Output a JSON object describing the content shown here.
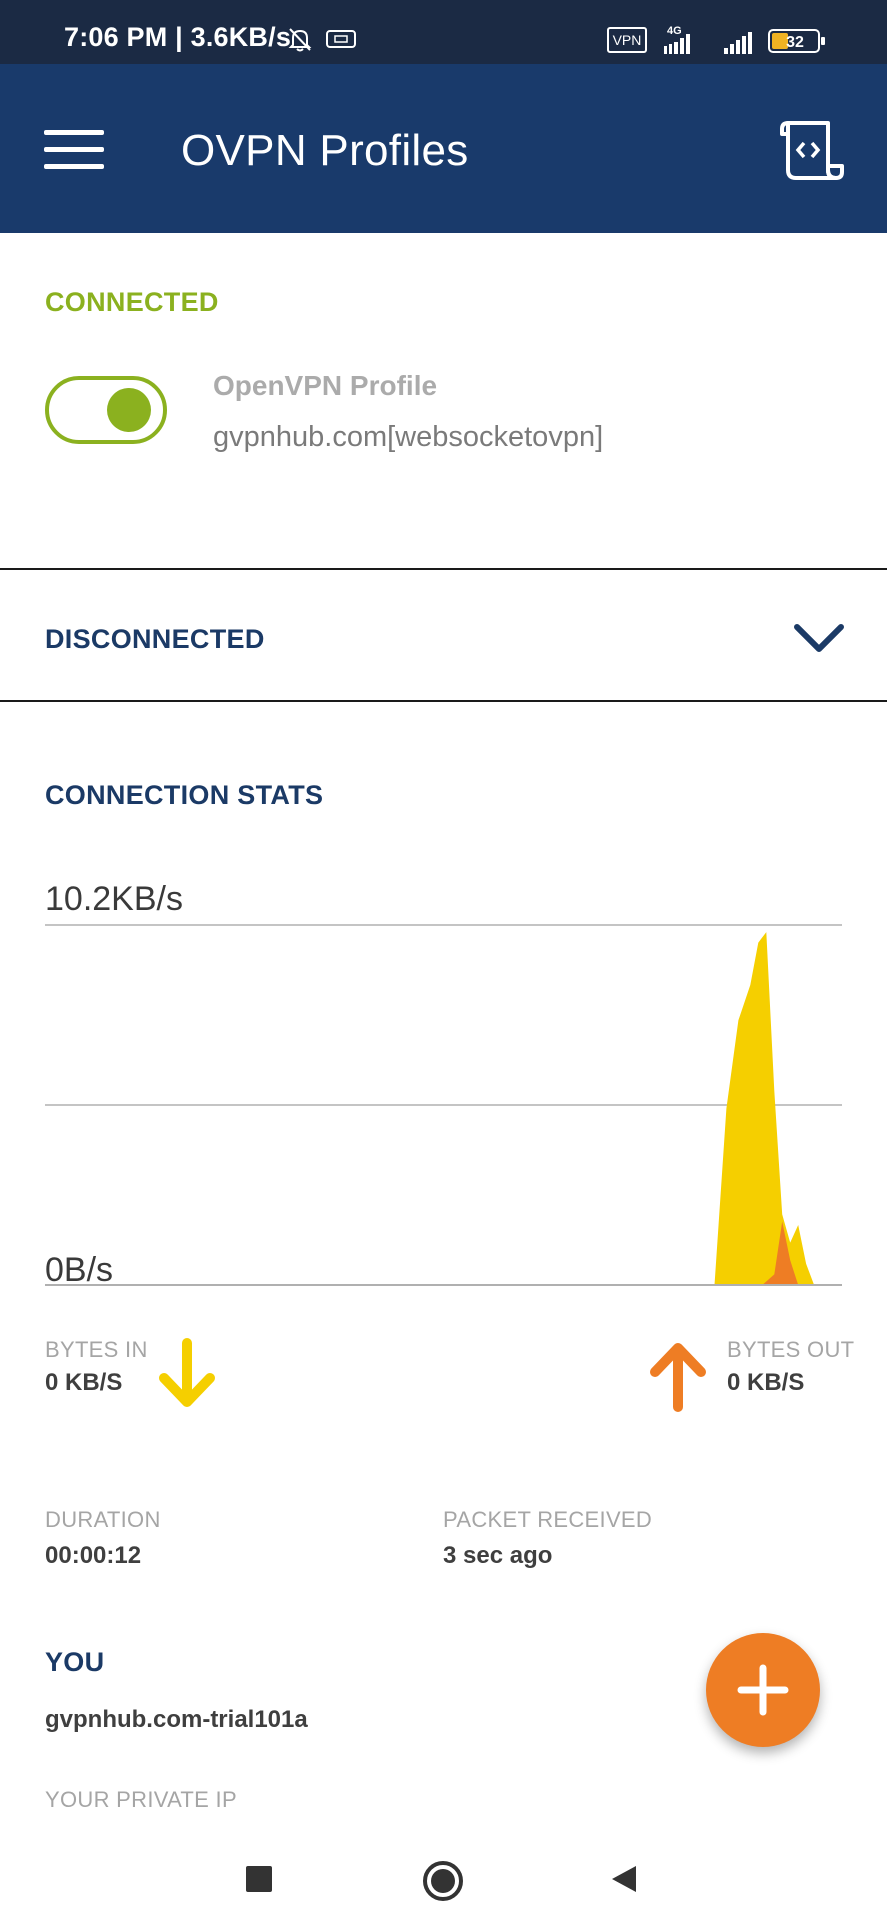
{
  "status_bar": {
    "time_speed": "7:06 PM | 3.6KB/s",
    "vpn_badge": "VPN",
    "network_type": "4G",
    "battery": "32",
    "icons": [
      "bell-off-icon",
      "card-icon",
      "vpn-icon",
      "signal-icon",
      "battery-icon"
    ]
  },
  "app_bar": {
    "title": "OVPN Profiles",
    "icons": [
      "menu-icon",
      "script-icon"
    ]
  },
  "connected_section": {
    "header": "CONNECTED",
    "profile_name": "OpenVPN Profile",
    "profile_server": "gvpnhub.com[websocketovpn]",
    "toggle_on": true
  },
  "disconnected_section": {
    "header": "DISCONNECTED",
    "icon": "chevron-down-icon"
  },
  "stats": {
    "header": "CONNECTION STATS",
    "bytes_in_label": "BYTES IN",
    "bytes_in_value": "0 KB/S",
    "bytes_out_label": "BYTES OUT",
    "bytes_out_value": "0 KB/S",
    "duration_label": "DURATION",
    "duration_value": "00:00:12",
    "packet_label": "PACKET RECEIVED",
    "packet_value": "3 sec ago"
  },
  "you_section": {
    "header": "YOU",
    "username": "gvpnhub.com-trial101a",
    "private_ip_label": "YOUR PRIVATE IP"
  },
  "colors": {
    "status_bar": "#1b2a44",
    "app_bar": "#193a6b",
    "connected_green": "#8bb11f",
    "navy_text": "#1b3a66",
    "bytes_in_yellow": "#f5cf00",
    "bytes_out_orange": "#ee7d24",
    "fab_orange": "#ee7d24"
  },
  "chart_data": {
    "type": "area",
    "y_top_label": "10.2KB/s",
    "y_bottom_label": "0B/s",
    "ylim": [
      0,
      10.2
    ],
    "y_unit": "KB/s",
    "series": [
      {
        "x": [
          0,
          0.1,
          0.2,
          0.3,
          0.4,
          0.5,
          0.6,
          0.7,
          0.8,
          0.84,
          0.855,
          0.87,
          0.885,
          0.895,
          0.905,
          0.915,
          0.925,
          0.935,
          0.945,
          0.955,
          0.965,
          0.975,
          0.985,
          1.0
        ],
        "values": [
          0,
          0,
          0,
          0,
          0,
          0,
          0,
          0,
          0,
          0,
          5.0,
          7.5,
          8.5,
          9.7,
          10.0,
          5.5,
          2.0,
          1.2,
          1.7,
          0.6,
          0,
          0,
          0,
          0
        ]
      },
      {
        "x": [
          0,
          0.5,
          0.9,
          0.915,
          0.925,
          0.935,
          0.945,
          1.0
        ],
        "values": [
          0,
          0,
          0,
          0.3,
          1.8,
          0.7,
          0,
          0
        ]
      }
    ]
  },
  "fab": {
    "icon": "plus-icon"
  },
  "nav_bar": {
    "icons": [
      "recent-apps-icon",
      "home-icon",
      "back-icon"
    ]
  }
}
